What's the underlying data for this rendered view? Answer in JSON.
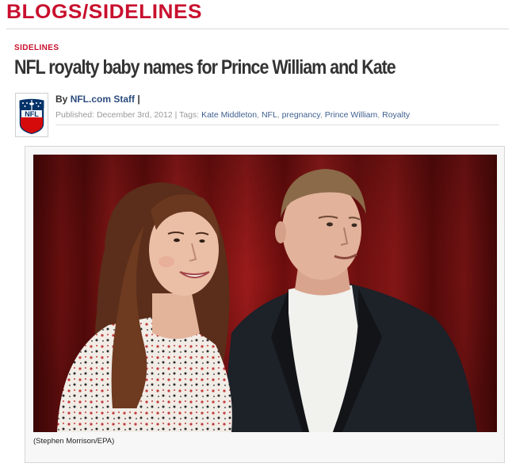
{
  "header": {
    "blog_title": "BLOGS/SIDELINES"
  },
  "article": {
    "section": "SIDELINES",
    "headline": "NFL royalty baby names for Prince William and Kate",
    "byline_prefix": "By",
    "author": "NFL.com Staff",
    "byline_sep": "|",
    "published": "Published: December 3rd, 2012 | Tags:",
    "tags": [
      "Kate Middleton",
      "NFL",
      "pregnancy",
      "Prince William",
      "Royalty"
    ],
    "photo_caption": "(Stephen Morrison/EPA)"
  },
  "colors": {
    "brand_red": "#c8102e",
    "link_blue": "#3f5f8f",
    "nfl_navy": "#013369"
  },
  "icons": {
    "logo": "nfl-shield-logo"
  }
}
